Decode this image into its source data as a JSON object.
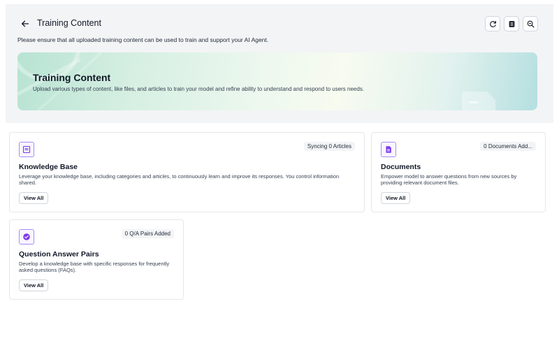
{
  "header": {
    "title": "Training Content",
    "subtitle": "Please ensure that all uploaded training content can be used to train and support your AI Agent.",
    "icons": [
      "arrow-left-icon",
      "refresh-icon",
      "document-list-icon",
      "zoom-out-icon"
    ]
  },
  "banner": {
    "title": "Training Content",
    "description": "Upload various types of content, like files, and articles to train your model and refine ability to understand and respond to users needs."
  },
  "cards": [
    {
      "icon": "knowledge-base-icon",
      "badge": "Syncing 0 Articles",
      "title": "Knowledge Base",
      "description": "Leverage your knowledge base, including categories and articles, to continuously learn and improve its responses. You control information shared.",
      "button": "View All"
    },
    {
      "icon": "document-icon",
      "badge": "0 Documents Add...",
      "title": "Documents",
      "description": "Empower model to answer questions from new sources by providing relevant document files.",
      "button": "View All"
    },
    {
      "icon": "qa-icon",
      "badge": "0 Q/A Pairs Added",
      "title": "Question Answer Pairs",
      "description": "Develop a knowledge base with specific responses for frequently asked questions (FAQs).",
      "button": "View All"
    }
  ],
  "colors": {
    "accent": "#7c3aed",
    "icon_border": "#a78bfa",
    "banner_start": "#b8e3d3",
    "banner_end": "#b5dfe0"
  }
}
